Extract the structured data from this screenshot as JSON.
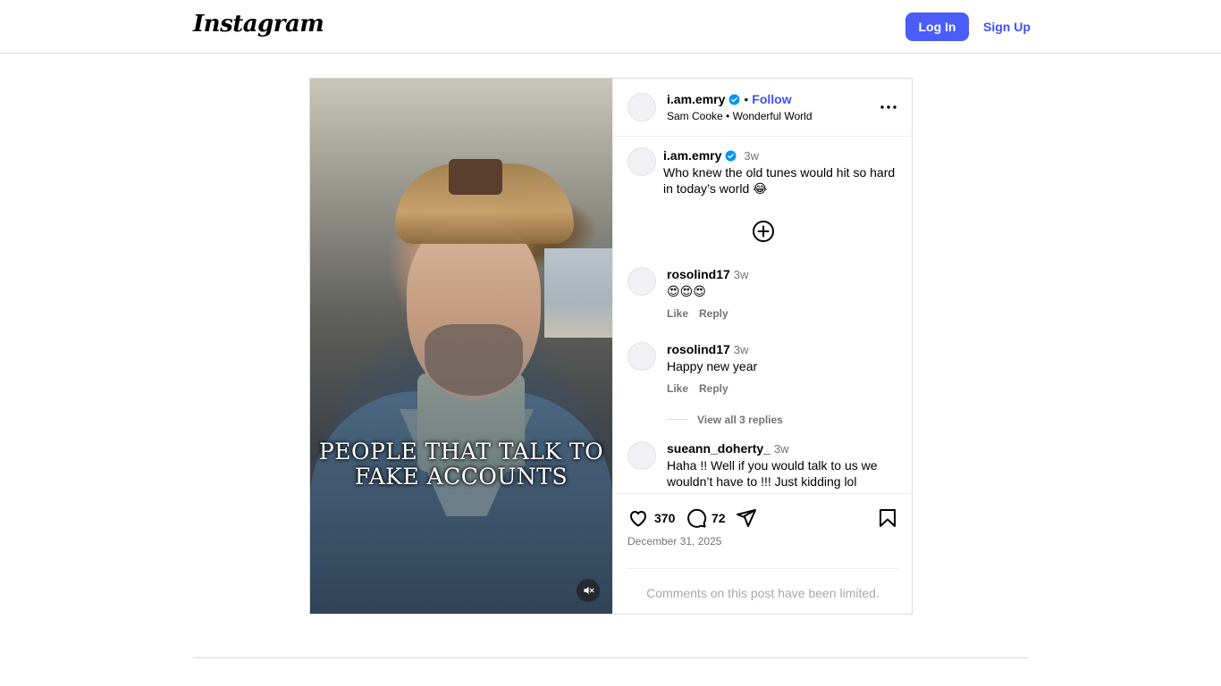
{
  "header": {
    "logo": "Instagram",
    "login_label": "Log In",
    "signup_label": "Sign Up"
  },
  "post": {
    "overlay_text": "PEOPLE THAT TALK TO FAKE ACCOUNTS",
    "author": {
      "username": "i.am.emry",
      "verified": true,
      "follow_label": "Follow",
      "separator": "•",
      "audio": "Sam Cooke • Wonderful World"
    },
    "caption": {
      "username": "i.am.emry",
      "time": "3w",
      "text": "Who knew the old tunes would hit so hard in today’s world 😂"
    },
    "comments": [
      {
        "username": "rosolind17",
        "time": "3w",
        "text": "😍😍😍",
        "like_label": "Like",
        "reply_label": "Reply"
      },
      {
        "username": "rosolind17",
        "time": "3w",
        "text": "Happy new year",
        "like_label": "Like",
        "reply_label": "Reply",
        "view_replies": "View all 3 replies"
      },
      {
        "username": "sueann_doherty_",
        "time": "3w",
        "text": "Haha !! Well if you would talk to us we wouldn’t have to !!! Just kidding lol"
      }
    ],
    "likes_count": "370",
    "comments_count": "72",
    "date": "December 31, 2025",
    "comments_limited": "Comments on this post have been limited."
  },
  "icons": {
    "more": "more-options-icon",
    "like": "heart-icon",
    "comment": "comment-icon",
    "share": "share-icon",
    "save": "bookmark-icon",
    "mute": "muted-speaker-icon",
    "load_more": "plus-circle-icon",
    "verified": "verified-badge-icon"
  },
  "colors": {
    "primary_button": "#4a5df9",
    "link_blue": "#4150f7",
    "verified_blue": "#0095f6",
    "muted_text": "#737373"
  }
}
